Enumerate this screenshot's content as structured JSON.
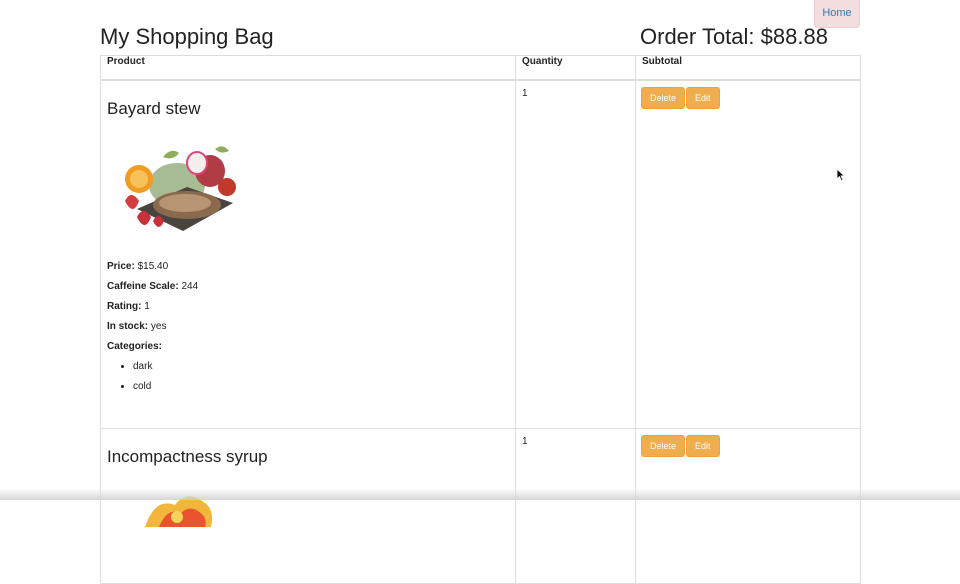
{
  "nav": {
    "home_label": "Home"
  },
  "header": {
    "title": "My Shopping Bag",
    "order_total": "Order Total: $88.88"
  },
  "table": {
    "headers": {
      "product": "Product",
      "quantity": "Quantity",
      "subtotal": "Subtotal"
    }
  },
  "labels": {
    "price": "Price:",
    "caffeine": "Caffeine Scale:",
    "rating": "Rating:",
    "in_stock": "In stock:",
    "categories": "Categories:"
  },
  "items": [
    {
      "name": "Bayard stew",
      "price": "$15.40",
      "caffeine": "244",
      "rating": "1",
      "in_stock": "yes",
      "categories": [
        "dark",
        "cold"
      ],
      "quantity": "1",
      "delete_label": "Delete",
      "edit_label": "Edit"
    },
    {
      "name": "Incompactness syrup",
      "quantity": "1",
      "delete_label": "Delete",
      "edit_label": "Edit"
    }
  ]
}
